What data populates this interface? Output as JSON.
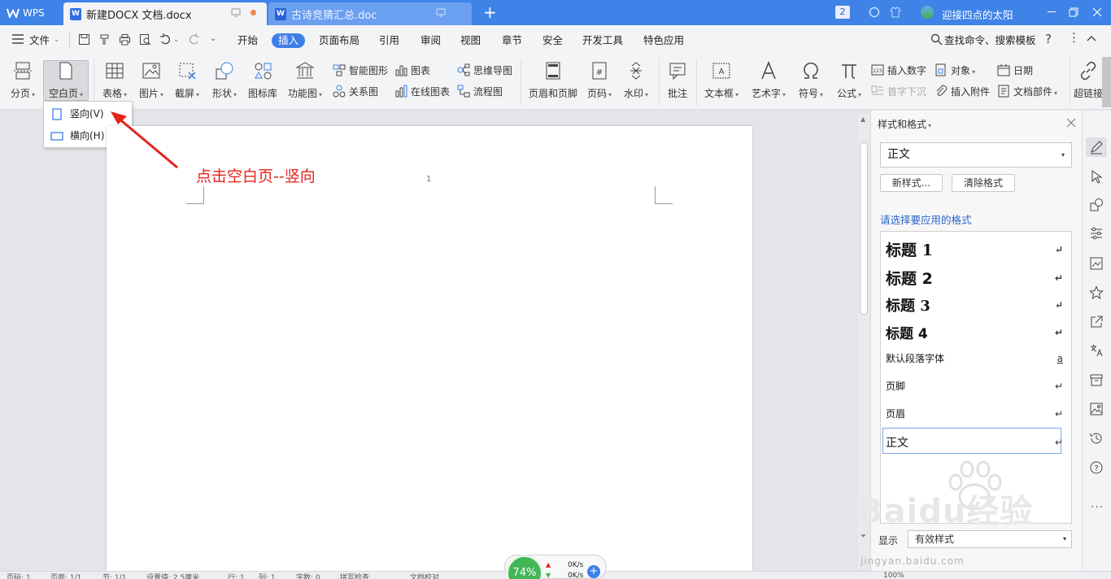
{
  "titlebar": {
    "app_label": "WPS",
    "tabs": [
      {
        "label": "新建DOCX 文档.docx"
      },
      {
        "label": "古诗竞猜汇总.doc"
      }
    ],
    "window_badge": "2",
    "user_name": "迎接四点的太阳"
  },
  "menu": {
    "file_label": "文件",
    "tabs": [
      "开始",
      "插入",
      "页面布局",
      "引用",
      "审阅",
      "视图",
      "章节",
      "安全",
      "开发工具",
      "特色应用"
    ],
    "search_label": "查找命令、搜索模板"
  },
  "ribbon": {
    "page_break": "分页",
    "blank_page": "空白页",
    "table": "表格",
    "picture": "图片",
    "screenshot": "截屏",
    "shape": "形状",
    "icon_library": "图标库",
    "function_chart": "功能图",
    "smart_shape": "智能图形",
    "chart": "图表",
    "mind_map": "思维导图",
    "relation_chart": "关系图",
    "online_chart": "在线图表",
    "flowchart": "流程图",
    "header_footer": "页眉和页脚",
    "page_number": "页码",
    "watermark": "水印",
    "comment": "批注",
    "textbox": "文本框",
    "wordart": "艺术字",
    "symbol": "符号",
    "formula": "公式",
    "insert_number": "插入数字",
    "object": "对象",
    "date": "日期",
    "drop_cap": "首字下沉",
    "insert_attachment": "插入附件",
    "doc_parts": "文档部件",
    "hyperlink": "超链接"
  },
  "dropdown": {
    "portrait": "竖向(V)",
    "landscape": "横向(H)"
  },
  "document": {
    "annotation": "点击空白页--竖向",
    "page_number": "1"
  },
  "panel": {
    "title": "样式和格式",
    "current_style": "正文",
    "new_style": "新样式...",
    "clear_format": "清除格式",
    "prompt": "请选择要应用的格式",
    "styles": [
      {
        "label": "标题  1",
        "mark": "↵"
      },
      {
        "label": "标题  2",
        "mark": "↵"
      },
      {
        "label": "标题  3",
        "mark": "↵"
      },
      {
        "label": "标题  4",
        "mark": "↵"
      },
      {
        "label": "默认段落字体",
        "mark": "a"
      },
      {
        "label": "页脚",
        "mark": "↵"
      },
      {
        "label": "页眉",
        "mark": "↵"
      },
      {
        "label": "正文",
        "mark": "↵"
      }
    ],
    "show_label": "显示",
    "show_value": "有效样式"
  },
  "status": {
    "items": [
      "页码: 1",
      "页面: 1/1",
      "节: 1/1",
      "设置值: 2.5厘米",
      "行: 1",
      "列: 1",
      "字数: 0",
      "拼写检查",
      "文档校对"
    ],
    "zoom": "100%",
    "cpu": "74%",
    "up_speed": "0K/s",
    "down_speed": "0K/s"
  },
  "watermark_text": "Baidu经验",
  "watermark_url": "jingyan.baidu.com",
  "colors": {
    "titlebar": "#3f83e8",
    "accent": "#3d7fe8",
    "annotation": "#e3231c"
  }
}
